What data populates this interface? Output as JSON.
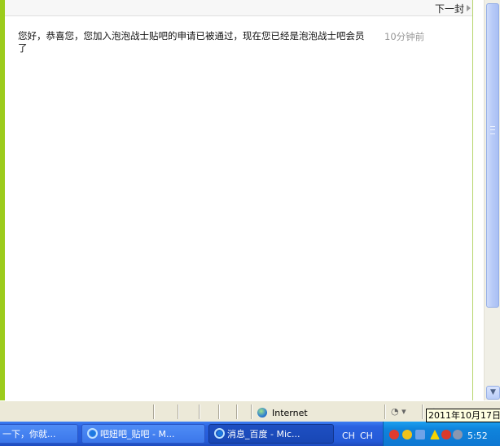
{
  "message": {
    "next_label": "下一封",
    "body": "您好，恭喜您，您加入泡泡战士贴吧的申请已被通过，现在您已经是泡泡战士吧会员了",
    "time": "10分钟前"
  },
  "statusbar": {
    "zone_label": "Internet"
  },
  "taskbar": {
    "buttons": [
      {
        "label": "一下，你就..."
      },
      {
        "label": "吧妞吧_贴吧 - M..."
      },
      {
        "label": "消息_百度 - Mic..."
      }
    ],
    "lang": "CH",
    "lang2": "CH",
    "clock": "5:52",
    "date_tooltip": "2011年10月17日"
  }
}
